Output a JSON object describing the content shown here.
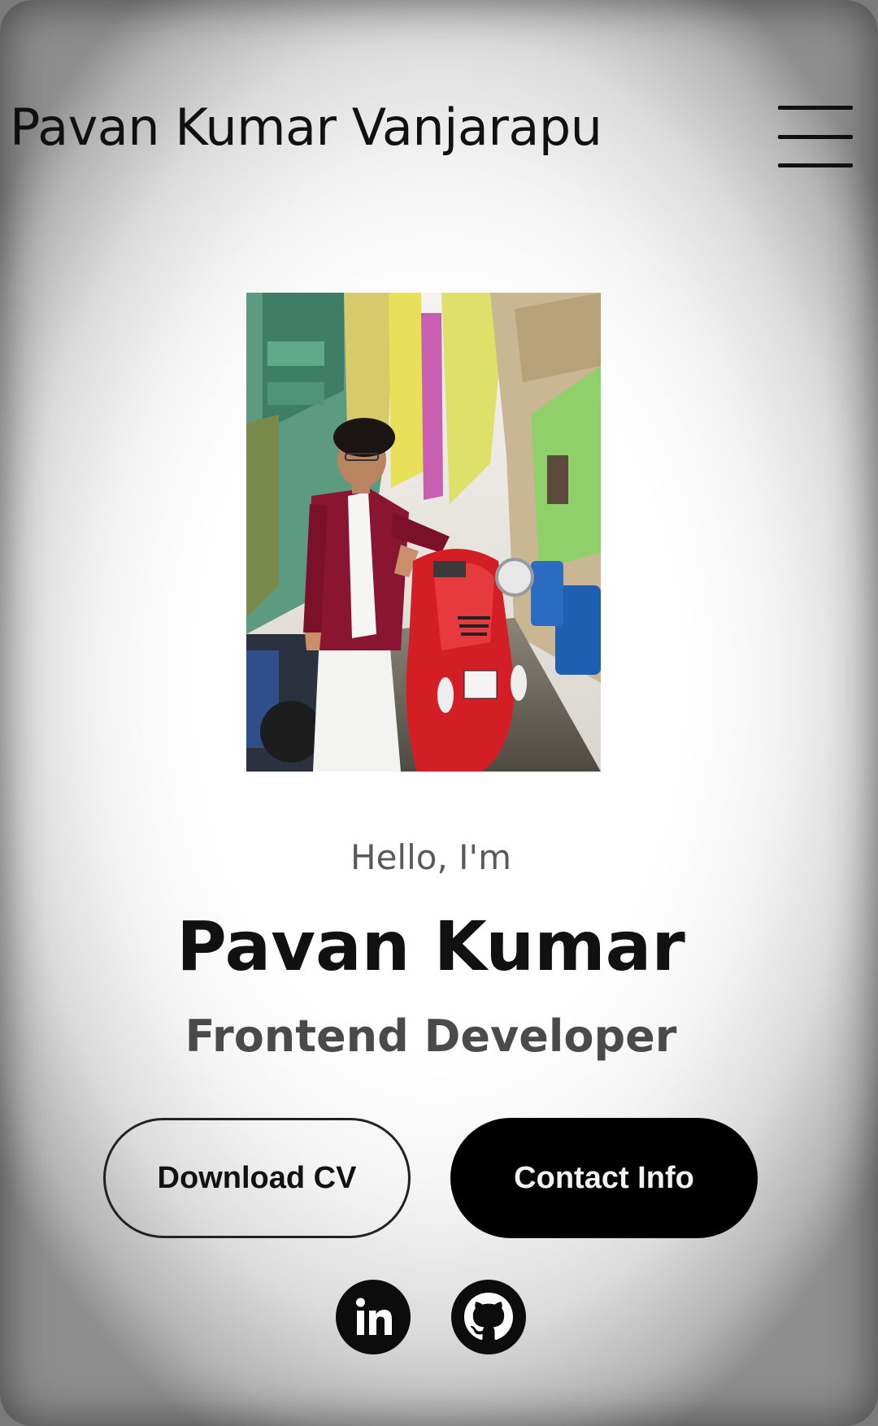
{
  "header": {
    "site_title": "Pavan Kumar Vanjarapu",
    "menu_icon": "hamburger-menu-icon"
  },
  "hero": {
    "greeting": "Hello, I'm",
    "name": "Pavan Kumar",
    "role": "Frontend Developer",
    "photo": "profile-photo"
  },
  "actions": {
    "download_cv_label": "Download CV",
    "contact_info_label": "Contact Info"
  },
  "social": [
    {
      "icon": "linkedin-icon"
    },
    {
      "icon": "github-icon"
    }
  ],
  "colors": {
    "text_primary": "#111111",
    "text_secondary": "#5a5a5a",
    "button_solid_bg": "#000000",
    "button_solid_text": "#f2f2f2"
  }
}
